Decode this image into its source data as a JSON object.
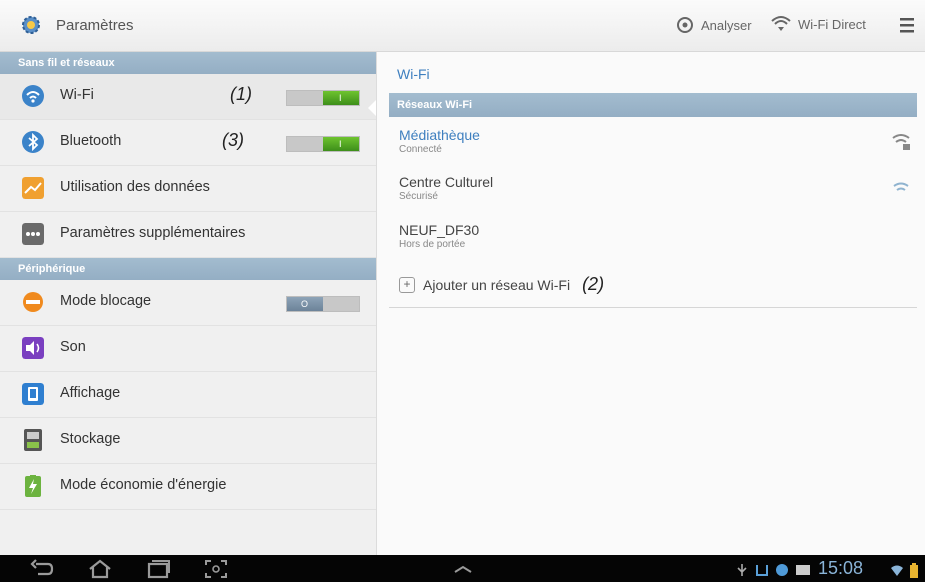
{
  "topbar": {
    "title": "Paramètres",
    "actions": [
      {
        "label": "Analyser",
        "icon": "scan-icon"
      },
      {
        "label": "Wi-Fi Direct",
        "icon": "wifi-direct-icon"
      }
    ],
    "menu_icon": "overflow-menu-icon"
  },
  "left": {
    "sections": [
      {
        "header": "Sans fil et réseaux",
        "items": [
          {
            "label": "Wi-Fi",
            "icon": "wifi-icon",
            "toggle": "on",
            "toggle_text": "I",
            "annotation": "(1)"
          },
          {
            "label": "Bluetooth",
            "icon": "bluetooth-icon",
            "toggle": "on",
            "toggle_text": "I",
            "annotation": "(3)"
          },
          {
            "label": "Utilisation des données",
            "icon": "data-usage-icon"
          },
          {
            "label": "Paramètres supplémentaires",
            "icon": "more-settings-icon"
          }
        ]
      },
      {
        "header": "Périphérique",
        "items": [
          {
            "label": "Mode blocage",
            "icon": "blocking-mode-icon",
            "toggle": "off",
            "toggle_text": "O"
          },
          {
            "label": "Son",
            "icon": "sound-icon"
          },
          {
            "label": "Affichage",
            "icon": "display-icon"
          },
          {
            "label": "Stockage",
            "icon": "storage-icon"
          },
          {
            "label": "Mode économie d'énergie",
            "icon": "power-saving-icon"
          }
        ]
      }
    ]
  },
  "right": {
    "title": "Wi-Fi",
    "section_header": "Réseaux Wi-Fi",
    "networks": [
      {
        "name": "Médiathèque",
        "status": "Connecté"
      },
      {
        "name": "Centre Culturel",
        "status": "Sécurisé"
      },
      {
        "name": "NEUF_DF30",
        "status": "Hors de portée"
      }
    ],
    "add_network": {
      "label": "Ajouter un réseau Wi-Fi",
      "annotation": "(2)"
    }
  },
  "navbar": {
    "time": "15:08",
    "buttons": [
      "back-icon",
      "home-icon",
      "recent-apps-icon",
      "screenshot-icon"
    ]
  },
  "colors": {
    "section_header": "#9bb5ca",
    "toggle_on": "#4fa623",
    "accent_text": "#3e7fbf",
    "navbar": "#050505"
  }
}
